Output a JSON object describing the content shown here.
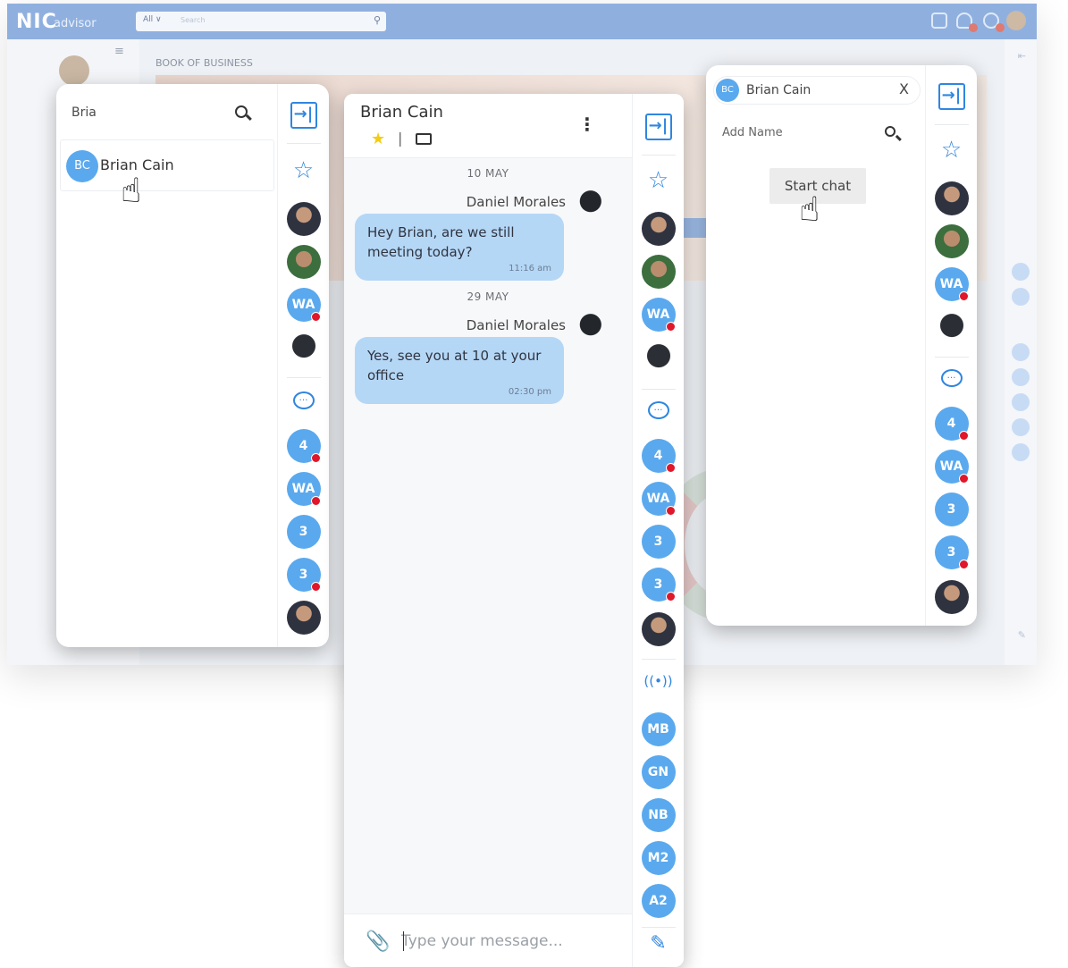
{
  "background_app": {
    "logo": "NIC",
    "logo_sub": "advisor",
    "search_scope": "All ∨",
    "search_placeholder": "Search",
    "page_title": "BOOK OF BUSINESS"
  },
  "search_panel": {
    "query": "Bria",
    "result": {
      "initials": "BC",
      "name": "Brian Cain"
    }
  },
  "chat_panel": {
    "contact_name": "Brian Cain",
    "messages": [
      {
        "date": "10 MAY",
        "sender": "Daniel Morales",
        "text": "Hey Brian, are we still meeting today?",
        "time": "11:16 am"
      },
      {
        "date": "29 MAY",
        "sender": "Daniel Morales",
        "text": "Yes, see you at 10 at your office",
        "time": "02:30 pm"
      }
    ],
    "input_placeholder": "Type your message..."
  },
  "start_panel": {
    "chip_initials": "BC",
    "chip_name": "Brian Cain",
    "chip_close": "X",
    "add_name_label": "Add Name",
    "start_button": "Start chat"
  },
  "rail": {
    "collapse_glyph": "→|",
    "star_glyph": "☆",
    "badges": [
      "WA",
      "4",
      "WA",
      "3",
      "3"
    ],
    "chat_badges": [
      "4",
      "WA",
      "3",
      "3"
    ],
    "channel_badges": [
      "MB",
      "GN",
      "NB",
      "M2",
      "A2"
    ],
    "signal_glyph": "((•))",
    "compose_glyph": "✎"
  },
  "colors": {
    "accent": "#2f86e0",
    "bubble": "#b5d7f6",
    "badge": "#5aa9ee",
    "presence_dot": "#e0172b",
    "favorite": "#f2cd12"
  }
}
